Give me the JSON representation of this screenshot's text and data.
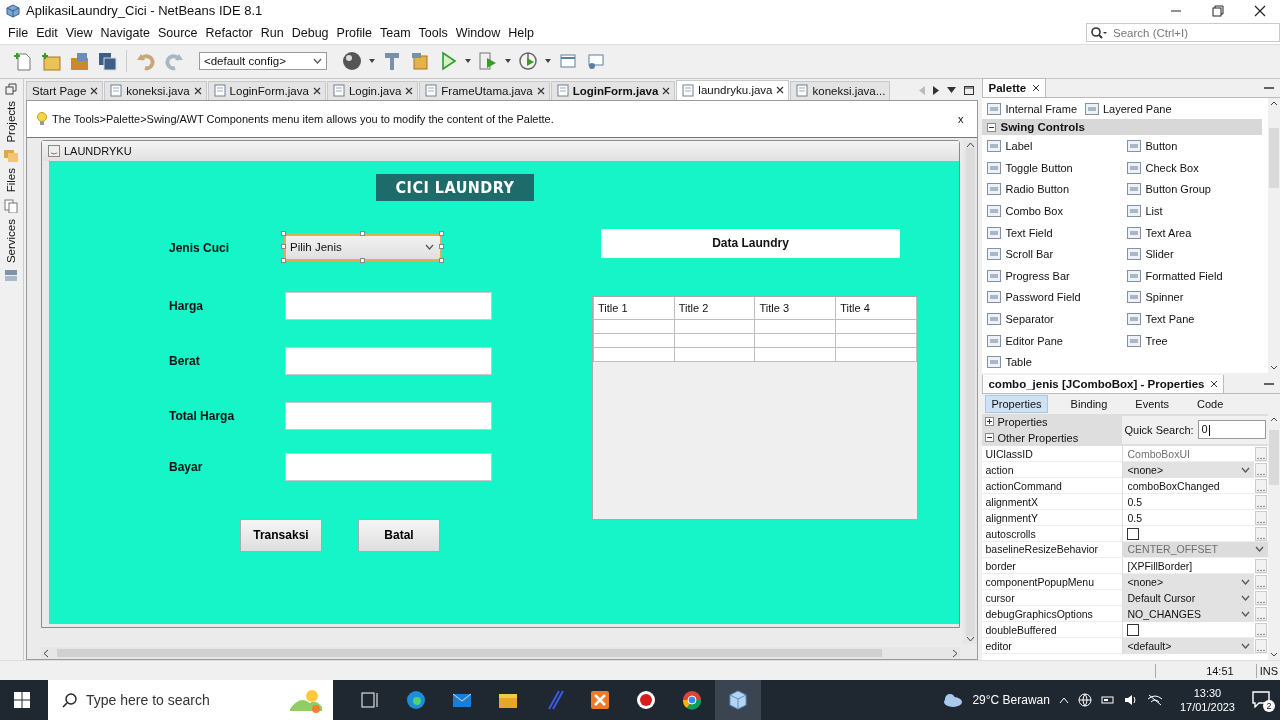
{
  "window": {
    "title": "AplikasiLaundry_Cici - NetBeans IDE 8.1"
  },
  "menu": [
    "File",
    "Edit",
    "View",
    "Navigate",
    "Source",
    "Refactor",
    "Run",
    "Debug",
    "Profile",
    "Team",
    "Tools",
    "Window",
    "Help"
  ],
  "search": {
    "placeholder": "Search (Ctrl+I)"
  },
  "toolbar": {
    "config": "<default config>"
  },
  "side_tabs": [
    {
      "label": "Projects"
    },
    {
      "label": "Files"
    },
    {
      "label": "Services"
    }
  ],
  "editor_tabs": [
    {
      "label": "Start Page",
      "selected": false,
      "modified": false,
      "kind": "page"
    },
    {
      "label": "koneksi.java",
      "selected": false,
      "modified": false,
      "kind": "file"
    },
    {
      "label": "LoginForm.java",
      "selected": false,
      "modified": false,
      "kind": "file"
    },
    {
      "label": "Login.java",
      "selected": false,
      "modified": false,
      "kind": "file"
    },
    {
      "label": "FrameUtama.java",
      "selected": false,
      "modified": false,
      "kind": "file"
    },
    {
      "label": "LoginForm.java",
      "selected": false,
      "modified": true,
      "kind": "file"
    },
    {
      "label": "laundryku.java",
      "selected": true,
      "modified": false,
      "kind": "file"
    },
    {
      "label": "koneksi.java...",
      "selected": false,
      "modified": false,
      "kind": "partial"
    }
  ],
  "hint": {
    "text": "The Tools>Palette>Swing/AWT Components menu item allows you to modify the content of the Palette.",
    "close": "x"
  },
  "form": {
    "title": "LAUNDRYKU",
    "heading": "CICI LAUNDRY",
    "fields": [
      {
        "label": "Jenis Cuci",
        "kind": "combo",
        "value": "Pilih Jenis",
        "selected": true
      },
      {
        "label": "Harga",
        "kind": "text",
        "selected": false
      },
      {
        "label": "Berat",
        "kind": "text",
        "selected": false
      },
      {
        "label": "Total Harga",
        "kind": "text",
        "selected": false
      },
      {
        "label": "Bayar",
        "kind": "text",
        "selected": false
      }
    ],
    "buttons": [
      "Transaksi",
      "Batal"
    ],
    "table_title": "Data Laundry",
    "table": {
      "columns": [
        "Title 1",
        "Title 2",
        "Title 3",
        "Title 4"
      ]
    }
  },
  "palette": {
    "title": "Palette",
    "top_items": [
      "Internal Frame",
      "Layered Pane"
    ],
    "categories": [
      {
        "label": "Swing Controls",
        "expanded": true,
        "items": [
          "Label",
          "Button",
          "Toggle Button",
          "Check Box",
          "Radio Button",
          "Button Group",
          "Combo Box",
          "List",
          "Text Field",
          "Text Area",
          "Scroll Bar",
          "Slider",
          "Progress Bar",
          "Formatted Field",
          "Password Field",
          "Spinner",
          "Separator",
          "Text Pane",
          "Editor Pane",
          "Tree",
          "Table"
        ]
      }
    ]
  },
  "properties": {
    "title": "combo_jenis [JComboBox] - Properties",
    "tabs": [
      {
        "label": "Properties",
        "selected": true
      },
      {
        "label": "Binding",
        "selected": false
      },
      {
        "label": "Events",
        "selected": false
      },
      {
        "label": "Code",
        "selected": false
      }
    ],
    "groups": [
      {
        "label": "Properties",
        "expanded": false
      },
      {
        "label": "Other Properties",
        "expanded": true
      }
    ],
    "quick_search": {
      "label": "Quick Search:",
      "value": "0"
    },
    "rows": [
      {
        "name": "UIClassID",
        "value": "ComboBoxUI",
        "kind": "text",
        "disabled": true
      },
      {
        "name": "action",
        "value": "<none>",
        "kind": "combo",
        "disabled": false
      },
      {
        "name": "actionCommand",
        "value": "comboBoxChanged",
        "kind": "text",
        "disabled": false
      },
      {
        "name": "alignmentX",
        "value": "0.5",
        "kind": "text",
        "disabled": false
      },
      {
        "name": "alignmentY",
        "value": "0.5",
        "kind": "text",
        "disabled": false
      },
      {
        "name": "autoscrolls",
        "kind": "check",
        "checked": false
      },
      {
        "name": "baselineResizeBehavior",
        "value": "CENTER_OFFSET",
        "kind": "combo",
        "disabled": true
      },
      {
        "name": "border",
        "value": "[XPFillBorder]",
        "kind": "text",
        "disabled": false
      },
      {
        "name": "componentPopupMenu",
        "value": "<none>",
        "kind": "combo",
        "disabled": false
      },
      {
        "name": "cursor",
        "value": "Default Cursor",
        "kind": "combo",
        "disabled": false
      },
      {
        "name": "debugGraphicsOptions",
        "value": "NO_CHANGES",
        "kind": "combo",
        "disabled": false
      },
      {
        "name": "doubleBuffered",
        "kind": "check",
        "checked": false
      },
      {
        "name": "editor",
        "value": "<default>",
        "kind": "combo",
        "disabled": false
      }
    ]
  },
  "status_bar": {
    "position": "14:51",
    "mode": "INS"
  },
  "taskbar": {
    "search_placeholder": "Type here to search",
    "weather": "29°C Berawan",
    "time": "13:30",
    "date": "17/01/2023",
    "notifications": "2"
  }
}
